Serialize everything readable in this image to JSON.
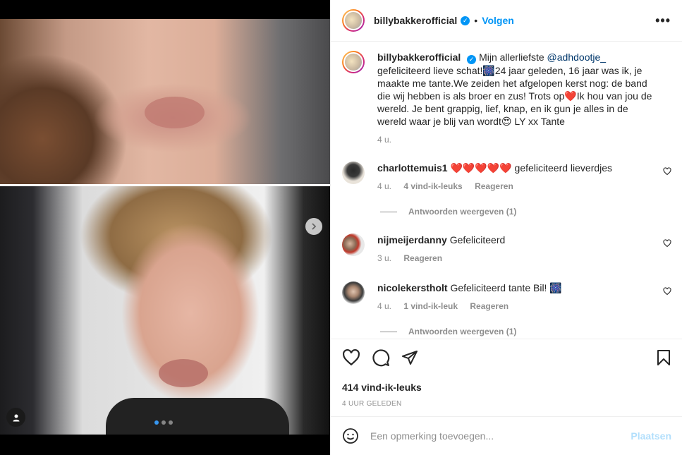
{
  "post": {
    "username": "billybakkerofficial",
    "follow_label": "Volgen",
    "separator": "•",
    "more_label": "•••",
    "caption": {
      "text_1": "Mijn allerliefste ",
      "mention": "@adhdootje_",
      "text_2": " gefeliciteerd lieve schat!🎆24 jaar geleden, 16 jaar was ik, je maakte me tante.We zeiden het afgelopen kerst nog: de band die wij hebben is als broer en zus! Trots op❤️Ik hou van jou de wereld. Je bent grappig, lief, knap, en ik gun je alles in de wereld waar je blij van wordt😍 LY xx Tante",
      "time": "4 u."
    },
    "comments": [
      {
        "username": "charlottemuis1",
        "text": "❤️❤️❤️❤️❤️ gefeliciteerd lieverdjes",
        "time": "4 u.",
        "likes": "4 vind-ik-leuks",
        "reply": "Reageren",
        "view_replies": "Antwoorden weergeven (1)"
      },
      {
        "username": "nijmeijerdanny",
        "text": "Gefeliciteerd",
        "time": "3 u.",
        "reply": "Reageren"
      },
      {
        "username": "nicolekerstholt",
        "text": "Gefeliciteerd tante Bil! 🎆",
        "time": "4 u.",
        "likes": "1 vind-ik-leuk",
        "reply": "Reageren",
        "view_replies": "Antwoorden weergeven (1)"
      }
    ],
    "like_count": "414 vind-ik-leuks",
    "posted_time": "4 UUR GELEDEN",
    "add_comment": {
      "placeholder": "Een opmerking toevoegen...",
      "post_label": "Plaatsen"
    },
    "carousel": {
      "count": 3,
      "active": 0
    }
  },
  "colors": {
    "accent": "#0095f6",
    "link": "#00376b",
    "muted": "#8e8e8e",
    "post_disabled": "#b2dffc"
  }
}
